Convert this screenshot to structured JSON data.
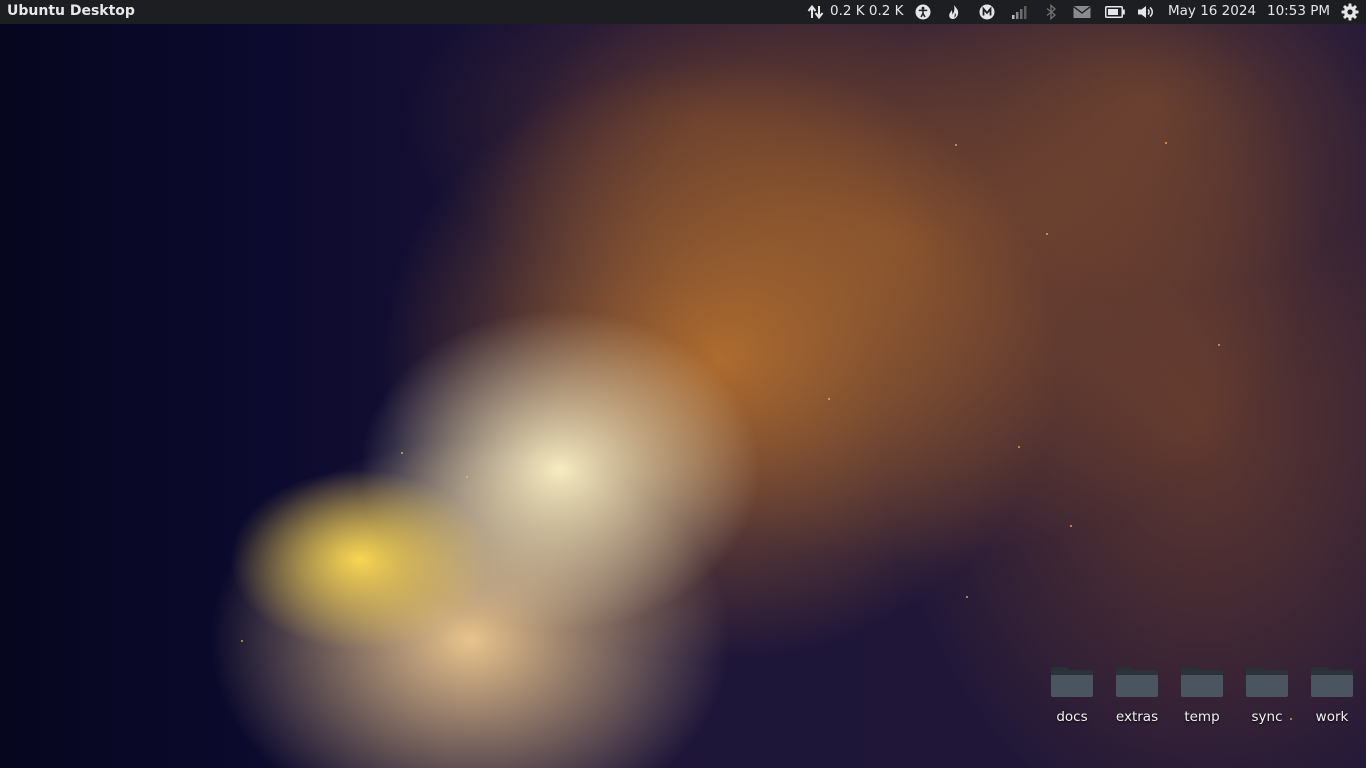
{
  "panel": {
    "title": "Ubuntu Desktop",
    "network_speed": "0.2 K 0.2 K",
    "date": "May 16 2024",
    "time": "10:53 PM",
    "indicators": [
      "network-updown-icon",
      "accessibility-icon",
      "flame-icon",
      "m-icon",
      "signal-bars-icon",
      "bluetooth-icon",
      "mail-icon",
      "battery-icon",
      "volume-icon",
      "gear-icon"
    ]
  },
  "desktop": {
    "icons": [
      {
        "label": "docs"
      },
      {
        "label": "extras"
      },
      {
        "label": "temp"
      },
      {
        "label": "sync"
      },
      {
        "label": "work"
      }
    ]
  },
  "colors": {
    "panel_bg": "#1c1e22",
    "panel_text": "#e6e6e6",
    "folder_front": "#4b5560",
    "folder_back": "#2c3238"
  }
}
